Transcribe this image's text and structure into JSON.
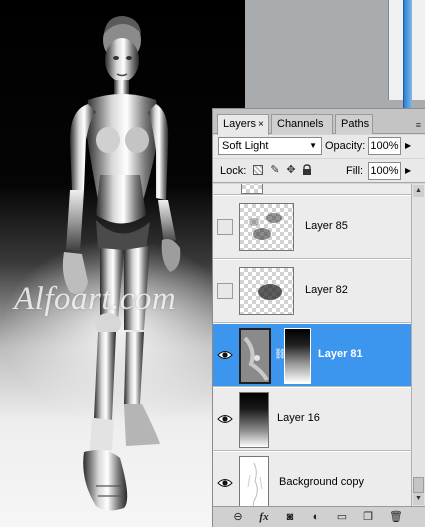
{
  "artwork": {
    "watermark": "Alfoart.com"
  },
  "layers_panel": {
    "tabs": [
      {
        "label": "Layers",
        "active": true,
        "close": "×"
      },
      {
        "label": "Channels",
        "active": false
      },
      {
        "label": "Paths",
        "active": false
      }
    ],
    "menu_icon": "≡",
    "blend_mode": "Soft Light",
    "opacity_label": "Opacity:",
    "opacity_value": "100%",
    "lock_label": "Lock:",
    "lock_icons": [
      "lock-transparent-icon",
      "lock-image-icon",
      "lock-position-icon",
      "lock-all-icon"
    ],
    "fill_label": "Fill:",
    "fill_value": "100%",
    "layers": [
      {
        "name": "Layer 85",
        "visible": false,
        "selected": false
      },
      {
        "name": "Layer 82",
        "visible": false,
        "selected": false
      },
      {
        "name": "Layer 81",
        "visible": true,
        "selected": true,
        "has_mask": true
      },
      {
        "name": "Layer 16",
        "visible": true,
        "selected": false
      },
      {
        "name": "Background copy",
        "visible": true,
        "selected": false
      }
    ],
    "bottom_icons": [
      "link-icon",
      "fx-icon",
      "add-mask-icon",
      "adjustment-icon",
      "new-group-icon",
      "new-layer-icon",
      "trash-icon"
    ],
    "fx_label": "fx",
    "colors": {
      "selected_row": "#3c96ed",
      "panel_bg": "#d6d6d6"
    }
  }
}
